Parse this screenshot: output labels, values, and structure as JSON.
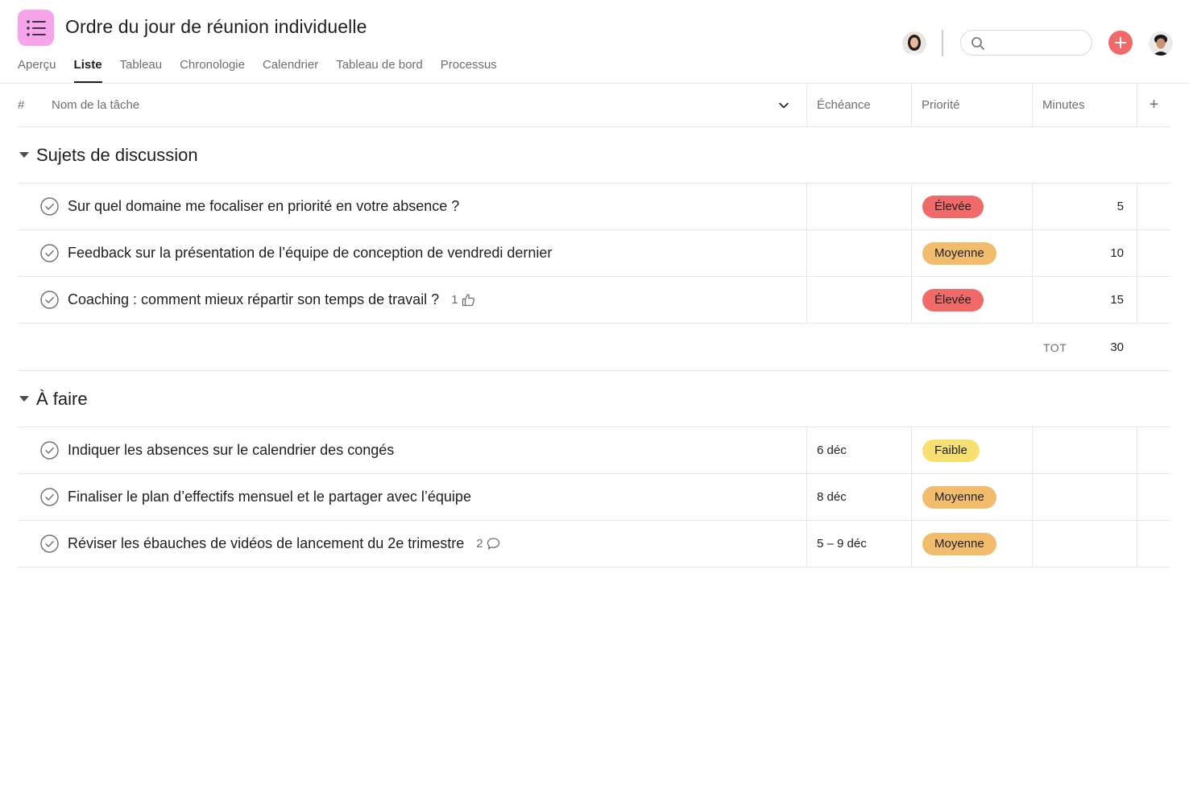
{
  "project": {
    "title": "Ordre du jour de réunion individuelle",
    "icon": "list-icon",
    "icon_color": "#f7a5ea"
  },
  "tabs": [
    {
      "label": "Aperçu",
      "active": false
    },
    {
      "label": "Liste",
      "active": true
    },
    {
      "label": "Tableau",
      "active": false
    },
    {
      "label": "Chronologie",
      "active": false
    },
    {
      "label": "Calendrier",
      "active": false
    },
    {
      "label": "Tableau de bord",
      "active": false
    },
    {
      "label": "Processus",
      "active": false
    }
  ],
  "search": {
    "placeholder": "",
    "value": ""
  },
  "columns": {
    "hash": "#",
    "name": "Nom de la tâche",
    "due": "Échéance",
    "priority": "Priorité",
    "minutes": "Minutes",
    "add": "+"
  },
  "sections": [
    {
      "title": "Sujets de discussion",
      "rows": [
        {
          "name": "Sur quel domaine me focaliser en priorité en votre absence ?",
          "due": "",
          "priority": "Élevée",
          "minutes": "5",
          "meta": ""
        },
        {
          "name": "Feedback sur la présentation de l’équipe de conception de vendredi dernier",
          "due": "",
          "priority": "Moyenne",
          "minutes": "10",
          "meta": ""
        },
        {
          "name": "Coaching : comment mieux répartir son temps de travail ?",
          "due": "",
          "priority": "Élevée",
          "minutes": "15",
          "meta": "1",
          "meta_icon": "thumbs-up-icon"
        }
      ],
      "total_label": "TOT",
      "total_value": "30"
    },
    {
      "title": "À faire",
      "rows": [
        {
          "name": "Indiquer les absences sur le calendrier des congés",
          "due": "6 déc",
          "priority": "Faible",
          "minutes": "",
          "meta": ""
        },
        {
          "name": "Finaliser le plan d’effectifs mensuel et le partager avec l’équipe",
          "due": "8 déc",
          "priority": "Moyenne",
          "minutes": "",
          "meta": ""
        },
        {
          "name": "Réviser les ébauches de vidéos de lancement du 2e trimestre",
          "due": "5 – 9 déc",
          "priority": "Moyenne",
          "minutes": "",
          "meta": "2",
          "meta_icon": "comment-icon"
        }
      ]
    }
  ],
  "colors": {
    "priority_high": "#f06a6a",
    "priority_medium": "#f1bd6c",
    "priority_low": "#f8df72",
    "add_button": "#f06a6a"
  }
}
